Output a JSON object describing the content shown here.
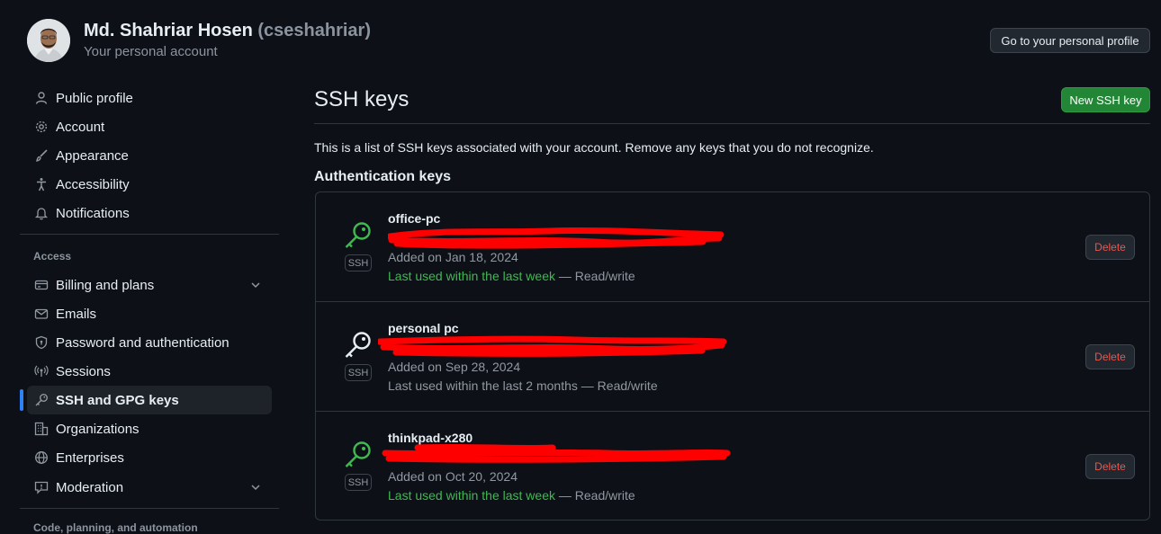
{
  "header": {
    "name": "Md. Shahriar Hosen",
    "handle": "(cseshahriar)",
    "subtitle": "Your personal account",
    "profile_button": "Go to your personal profile"
  },
  "sidebar": {
    "items": [
      {
        "label": "Public profile",
        "icon": "person-icon"
      },
      {
        "label": "Account",
        "icon": "gear-icon"
      },
      {
        "label": "Appearance",
        "icon": "paintbrush-icon"
      },
      {
        "label": "Accessibility",
        "icon": "accessibility-icon"
      },
      {
        "label": "Notifications",
        "icon": "bell-icon"
      }
    ],
    "access_heading": "Access",
    "access_items": [
      {
        "label": "Billing and plans",
        "icon": "credit-card-icon",
        "expandable": true
      },
      {
        "label": "Emails",
        "icon": "mail-icon"
      },
      {
        "label": "Password and authentication",
        "icon": "shield-lock-icon"
      },
      {
        "label": "Sessions",
        "icon": "broadcast-icon"
      },
      {
        "label": "SSH and GPG keys",
        "icon": "key-icon",
        "active": true
      },
      {
        "label": "Organizations",
        "icon": "organization-icon"
      },
      {
        "label": "Enterprises",
        "icon": "globe-icon"
      },
      {
        "label": "Moderation",
        "icon": "report-icon",
        "expandable": true
      }
    ],
    "next_heading": "Code, planning, and automation"
  },
  "main": {
    "title": "SSH keys",
    "new_button": "New SSH key",
    "description": "This is a list of SSH keys associated with your account. Remove any keys that you do not recognize.",
    "section_title": "Authentication keys",
    "keys": [
      {
        "title": "office-pc",
        "badge": "SSH",
        "added": "Added on Jan 18, 2024",
        "last_used": "Last used within the last week",
        "access": "— Read/write",
        "recent": true,
        "delete_label": "Delete"
      },
      {
        "title": "personal pc",
        "badge": "SSH",
        "added": "Added on Sep 28, 2024",
        "last_used": "Last used within the last 2 months",
        "access": "— Read/write",
        "recent": false,
        "delete_label": "Delete"
      },
      {
        "title": "thinkpad-x280",
        "badge": "SSH",
        "added": "Added on Oct 20, 2024",
        "last_used": "Last used within the last week",
        "access": "— Read/write",
        "recent": true,
        "delete_label": "Delete"
      }
    ]
  },
  "colors": {
    "background": "#0d1117",
    "accent_green": "#238636",
    "recent_text": "#3fb950",
    "danger": "#f85149",
    "redaction": "#ff0000",
    "active_indicator": "#2f81f7"
  }
}
